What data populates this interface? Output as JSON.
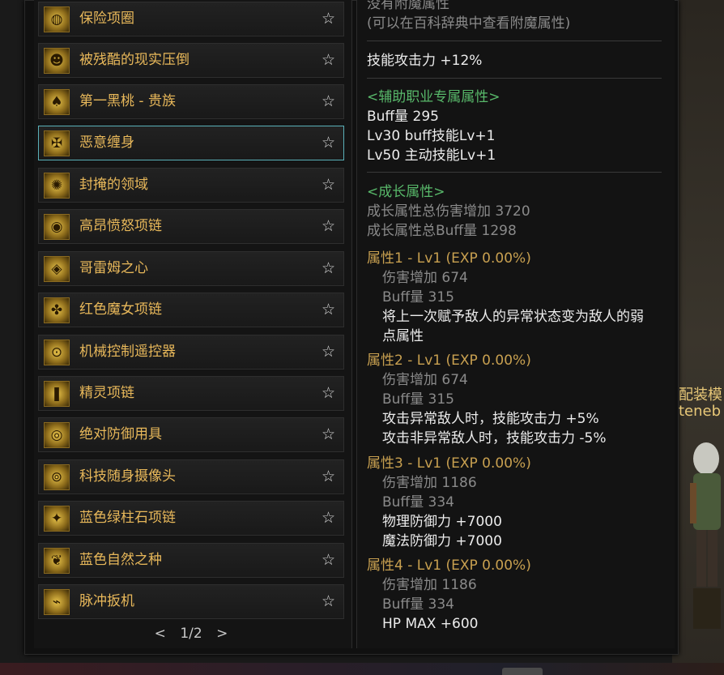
{
  "items": [
    {
      "name": "保险项圈",
      "selected": false
    },
    {
      "name": "被残酷的现实压倒",
      "selected": false
    },
    {
      "name": "第一黑桃 - 贵族",
      "selected": false
    },
    {
      "name": "恶意缠身",
      "selected": true
    },
    {
      "name": "封掩的领域",
      "selected": false
    },
    {
      "name": "高昂愤怒项链",
      "selected": false
    },
    {
      "name": "哥雷姆之心",
      "selected": false
    },
    {
      "name": "红色魔女项链",
      "selected": false
    },
    {
      "name": "机械控制遥控器",
      "selected": false
    },
    {
      "name": "精灵项链",
      "selected": false
    },
    {
      "name": "绝对防御用具",
      "selected": false
    },
    {
      "name": "科技随身摄像头",
      "selected": false
    },
    {
      "name": "蓝色绿柱石项链",
      "selected": false
    },
    {
      "name": "蓝色自然之种",
      "selected": false
    },
    {
      "name": "脉冲扳机",
      "selected": false
    }
  ],
  "pager": {
    "prev": "<",
    "page": "1/2",
    "next": ">"
  },
  "detail": {
    "enchant_none": "没有附魔属性",
    "enchant_hint": "(可以在百科辞典中查看附魔属性)",
    "skill_attack": "技能攻击力  +12%",
    "support_header": "<辅助职业专属属性>",
    "support_lines": [
      "Buff量  295",
      "Lv30 buff技能Lv+1",
      "Lv50 主动技能Lv+1"
    ],
    "growth_header": "<成长属性>",
    "growth_totals": [
      "成长属性总伤害增加 3720",
      "成长属性总Buff量 1298"
    ],
    "attrs": [
      {
        "title": "属性1 - Lv1 (EXP 0.00%)",
        "dmg": "伤害增加  674",
        "buff": "Buff量  315",
        "effects": [
          "将上一次赋予敌人的异常状态变为敌人的弱",
          "点属性"
        ]
      },
      {
        "title": "属性2 - Lv1 (EXP 0.00%)",
        "dmg": "伤害增加  674",
        "buff": "Buff量  315",
        "effects": [
          "攻击异常敌人时，技能攻击力 +5%",
          "攻击非异常敌人时，技能攻击力 -5%"
        ]
      },
      {
        "title": "属性3 - Lv1 (EXP 0.00%)",
        "dmg": "伤害增加  1186",
        "buff": "Buff量  334",
        "effects": [
          "物理防御力 +7000",
          "魔法防御力 +7000"
        ]
      },
      {
        "title": "属性4 - Lv1 (EXP 0.00%)",
        "dmg": "伤害增加  1186",
        "buff": "Buff量  334",
        "effects": [
          "HP MAX +600"
        ]
      }
    ]
  },
  "character": {
    "line1": "配装模",
    "line2": "teneb"
  },
  "icons": [
    "collar-icon",
    "grin-icon",
    "spade-card-icon",
    "chain-icon",
    "seal-icon",
    "mask-icon",
    "gem-heart-icon",
    "witch-necklace-icon",
    "remote-icon",
    "spirit-necklace-icon",
    "shield-icon",
    "camera-icon",
    "beryl-necklace-icon",
    "seed-icon",
    "trigger-icon"
  ],
  "colors": {
    "item_name": "#e8b85a",
    "selected_border": "#5ab0b8",
    "green_header": "#58b86a",
    "gold_attr": "#c8a050"
  }
}
